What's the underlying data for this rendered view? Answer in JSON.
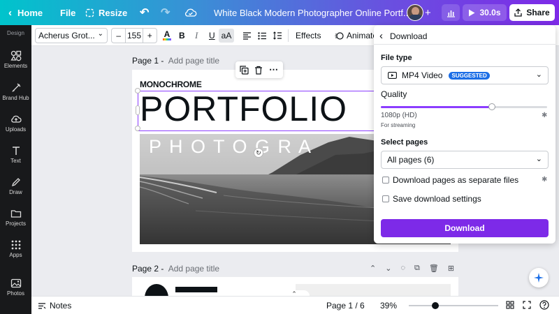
{
  "topbar": {
    "home_label": "Home",
    "file_label": "File",
    "resize_label": "Resize",
    "doc_title": "White Black Modern Photographer Online Portf...",
    "timer_label": "30.0s",
    "share_label": "Share"
  },
  "rail": {
    "section_label": "Design",
    "items": [
      {
        "label": "Elements",
        "icon": "elements-icon"
      },
      {
        "label": "Brand Hub",
        "icon": "brand-hub-icon"
      },
      {
        "label": "Uploads",
        "icon": "uploads-icon"
      },
      {
        "label": "Text",
        "icon": "text-icon"
      },
      {
        "label": "Draw",
        "icon": "draw-icon"
      },
      {
        "label": "Projects",
        "icon": "projects-icon"
      },
      {
        "label": "Apps",
        "icon": "apps-icon"
      },
      {
        "label": "Photos",
        "icon": "photos-icon"
      }
    ]
  },
  "toolbar": {
    "font_name": "Acherus Grot...",
    "font_size": "155",
    "minus": "–",
    "plus": "+",
    "bold": "B",
    "italic": "I",
    "underline": "U",
    "case": "aA",
    "effects_label": "Effects",
    "animate_label": "Animate"
  },
  "canvas": {
    "page1_label": "Page 1 -",
    "page1_title_placeholder": "Add page title",
    "page2_label": "Page 2 -",
    "page2_title_placeholder": "Add page title",
    "monochrome_text": "MONOCHROME",
    "portfolio_text": "PORTFOLIO",
    "photography_text": "P H O T O G R A"
  },
  "download_panel": {
    "title": "Download",
    "file_type_label": "File type",
    "file_type_value": "MP4 Video",
    "suggested_badge": "SUGGESTED",
    "quality_label": "Quality",
    "quality_value": "1080p (HD)",
    "quality_note": "For streaming",
    "quality_level_fraction": 0.67,
    "select_pages_label": "Select pages",
    "select_pages_value": "All pages (6)",
    "separate_files_label": "Download pages as separate files",
    "separate_files_checked": false,
    "save_settings_label": "Save download settings",
    "save_settings_checked": false,
    "download_button_label": "Download"
  },
  "bottombar": {
    "notes_label": "Notes",
    "page_indicator": "Page 1 / 6",
    "zoom_value": "39%",
    "zoom_level_fraction": 0.3
  },
  "colors": {
    "accent_purple": "#7d2ae8",
    "badge_blue": "#1b6ee6",
    "selection_purple": "#8b3dff"
  }
}
